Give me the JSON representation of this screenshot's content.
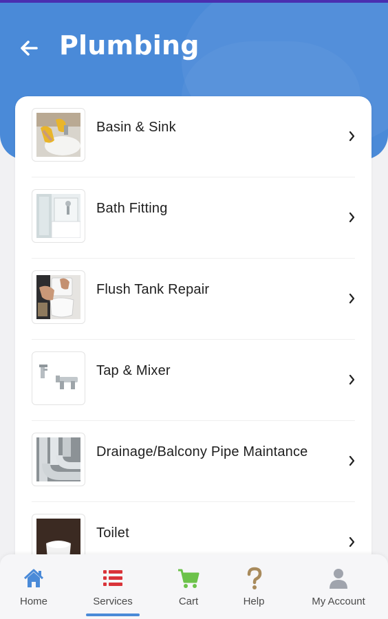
{
  "header": {
    "title": "Plumbing",
    "back_icon": "arrow-left-icon",
    "color": "#4a8ad8"
  },
  "services": [
    {
      "label": "Basin & Sink",
      "icon": "basin-sink-image"
    },
    {
      "label": "Bath Fitting",
      "icon": "bath-fitting-image"
    },
    {
      "label": "Flush Tank Repair",
      "icon": "flush-tank-image"
    },
    {
      "label": "Tap & Mixer",
      "icon": "tap-mixer-image"
    },
    {
      "label": "Drainage/Balcony Pipe Maintance",
      "icon": "drainage-pipe-image"
    },
    {
      "label": "Toilet",
      "icon": "toilet-image"
    }
  ],
  "bottom_nav": {
    "active": "Services",
    "items": [
      {
        "label": "Home",
        "icon": "home-icon",
        "color": "#4a8ad8"
      },
      {
        "label": "Services",
        "icon": "list-icon",
        "color": "#d9343a"
      },
      {
        "label": "Cart",
        "icon": "cart-icon",
        "color": "#6cc24a"
      },
      {
        "label": "Help",
        "icon": "question-icon",
        "color": "#a88a5c"
      },
      {
        "label": "My Account",
        "icon": "user-icon",
        "color": "#a0a4ad"
      }
    ]
  }
}
